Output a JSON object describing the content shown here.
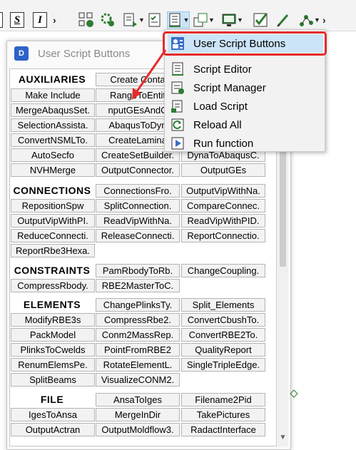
{
  "toolbar": {
    "format_buttons": [
      "S",
      "I"
    ],
    "icons": [
      "bold-box-icon",
      "strikethrough-icon",
      "italic-icon",
      "overflow-chevron-icon",
      "process-grid-icon",
      "settings-gears-icon",
      "document-arrow-icon",
      "checklist-icon",
      "script-list-icon",
      "window-stack-icon",
      "monitor-icon",
      "checkmark-icon",
      "pen-icon",
      "graph-nodes-icon",
      "overflow-chevron-icon"
    ],
    "accent": "#2e7d32"
  },
  "dialog": {
    "title": "User Script Buttons",
    "sections": [
      {
        "header": "AUXILIARIES",
        "buttons": [
          "Create Conta",
          "MergeAbaqusSet.",
          "SelectionAssista.",
          "ConvertNSMLTo.",
          "AutoSecfo",
          "NVHMerge",
          "Make Include",
          "RangeToEntit",
          "nputGEsAndC",
          "AbaqusToDyn",
          "CreateLamina",
          "CreateSetBuilder.",
          "OutputConnector.",
          "DynaToAbaqusC.",
          "OutputGEs"
        ]
      },
      {
        "header": "CONNECTIONS",
        "buttons": [
          "ConnectionsFro.",
          "OutputVipWithNa.",
          "RepositionSpw",
          "SplitConnection.",
          "CompareConnec.",
          "OutputVipWithPI.",
          "ReadVipWithNa.",
          "ReadVipWithPID.",
          "ReduceConnecti.",
          "ReleaseConnecti.",
          "ReportConnectio.",
          "ReportRbe3Hexa."
        ]
      },
      {
        "header": "CONSTRAINTS",
        "buttons": [
          "PamRbodyToRb.",
          "ChangeCoupling.",
          "CompressRbody.",
          "RBE2MasterToC."
        ]
      },
      {
        "header": "ELEMENTS",
        "buttons": [
          "ChangePlinksTy.",
          "Split_Elements",
          "ModifyRBE3s",
          "CompressRbe2.",
          "ConvertCbushTo.",
          "PackModel",
          "Conm2MassRep.",
          "ConvertRBE2To.",
          "PlinksToCwelds",
          "PointFromRBE2",
          "QualityReport",
          "RenumElemsPe.",
          "RotateElementL.",
          "SingleTripleEdge.",
          "SplitBeams",
          "VisualizeCONM2."
        ]
      },
      {
        "header": "FILE",
        "buttons": [
          "AnsaToIges",
          "Filename2Pid",
          "IgesToAnsa",
          "MergeInDir",
          "TakePictures",
          "OutputActran",
          "OutputMoldflow3.",
          "RadactInterface"
        ]
      }
    ]
  },
  "menu": {
    "items": [
      {
        "label": "User Script Buttons",
        "icon": "user-script-icon"
      },
      {
        "label": "Script Editor",
        "icon": "script-editor-icon"
      },
      {
        "label": "Script Manager",
        "icon": "script-manager-icon"
      },
      {
        "label": "Load Script",
        "icon": "load-script-icon"
      },
      {
        "label": "Reload All",
        "icon": "reload-all-icon"
      },
      {
        "label": "Run function",
        "icon": "run-function-icon"
      }
    ],
    "highlight_color": "#e52b2b",
    "active_color": "#cce4f7"
  }
}
